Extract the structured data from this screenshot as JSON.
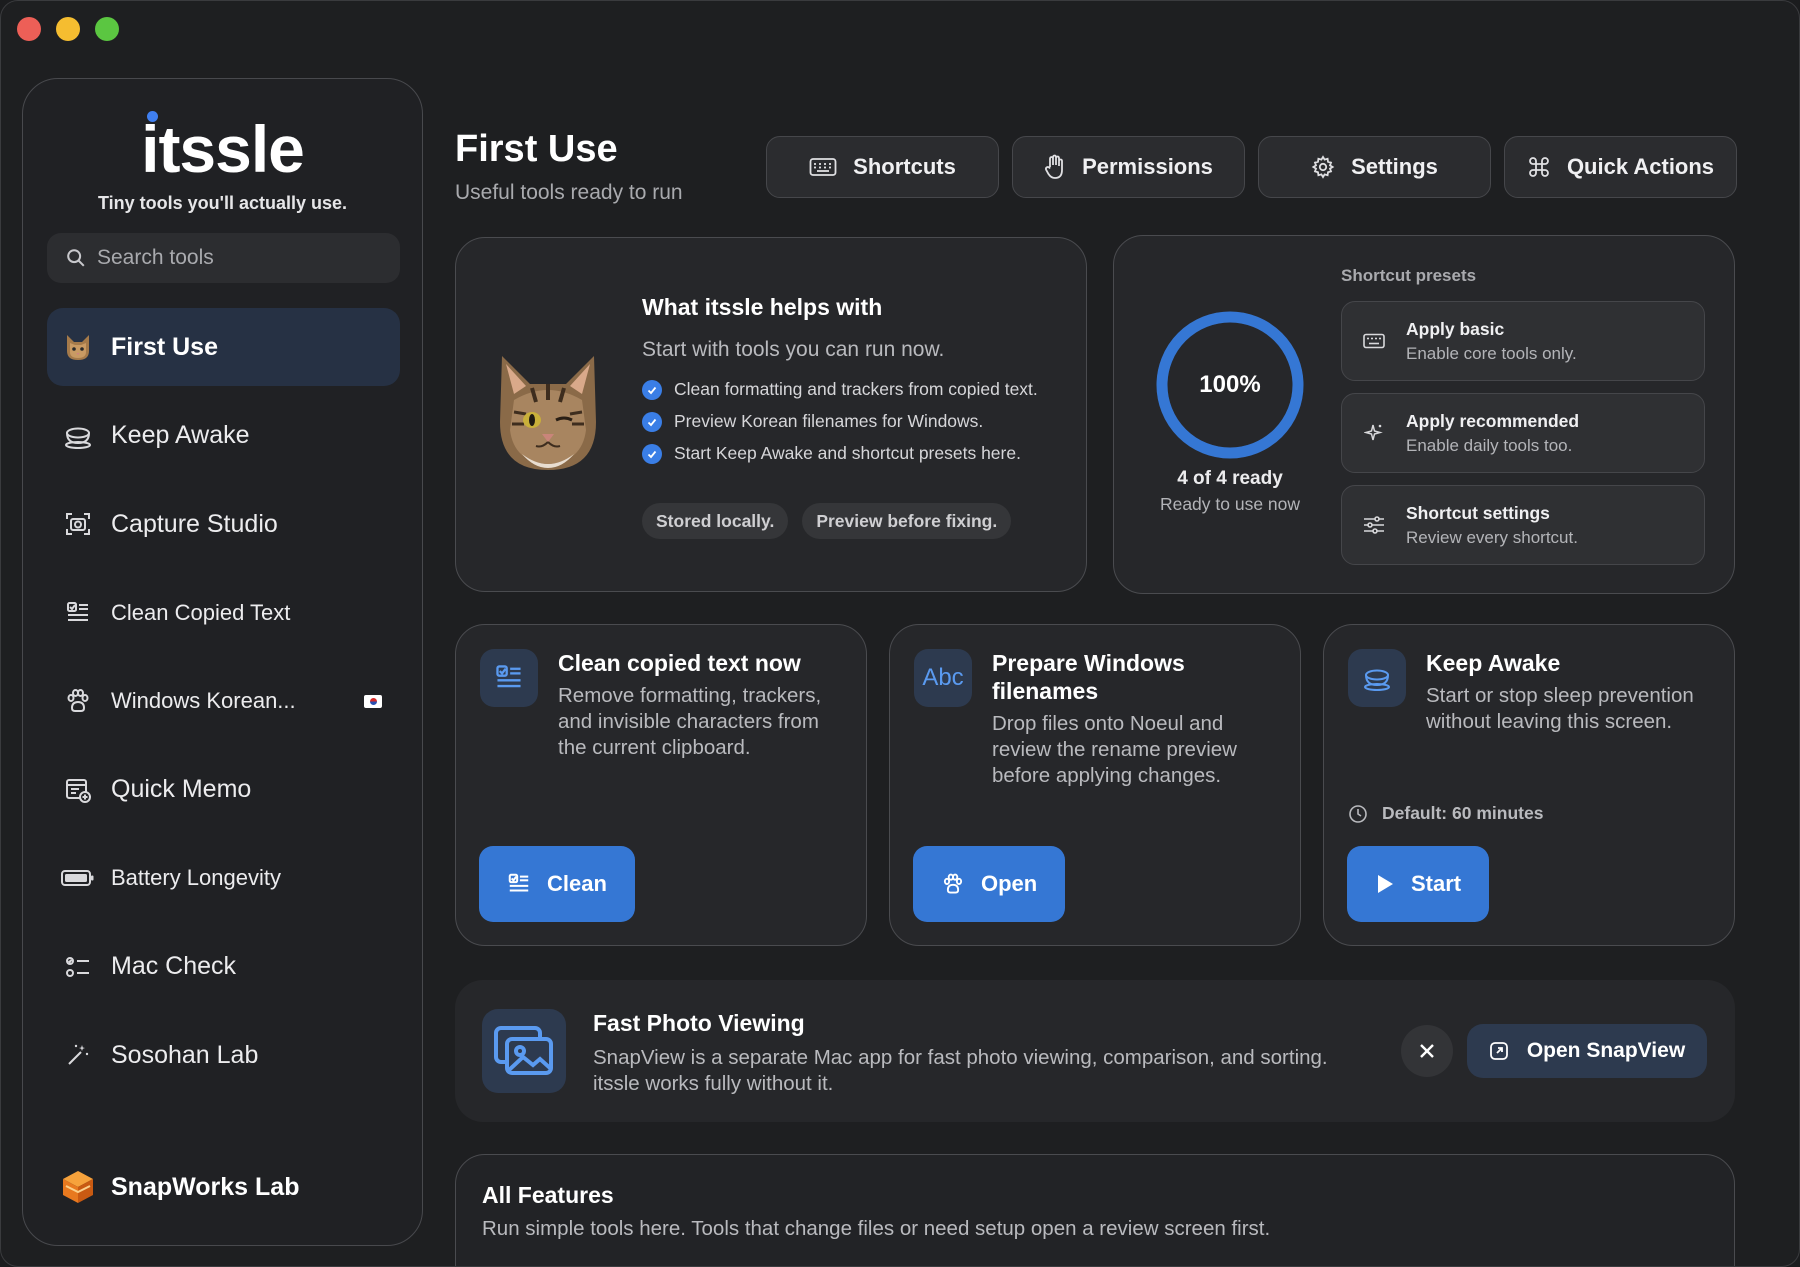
{
  "window": {
    "controls": [
      "close",
      "minimize",
      "maximize"
    ]
  },
  "sidebar": {
    "brand": "itssle",
    "tagline": "Tiny tools you'll actually use.",
    "search_placeholder": "Search tools",
    "items": [
      {
        "label": "First Use",
        "icon": "cat-icon",
        "active": true
      },
      {
        "label": "Keep Awake",
        "icon": "cup-icon"
      },
      {
        "label": "Capture Studio",
        "icon": "camera-viewfinder-icon"
      },
      {
        "label": "Clean Copied Text",
        "icon": "text-check-icon"
      },
      {
        "label": "Windows Korean...",
        "icon": "paw-icon",
        "badge": "korea-flag-icon"
      },
      {
        "label": "Quick Memo",
        "icon": "memo-add-icon"
      },
      {
        "label": "Battery Longevity",
        "icon": "battery-icon"
      },
      {
        "label": "Mac Check",
        "icon": "checklist-icon"
      },
      {
        "label": "Sosohan Lab",
        "icon": "magic-wand-icon"
      }
    ],
    "footer": "SnapWorks Lab"
  },
  "header": {
    "title": "First Use",
    "subtitle": "Useful tools ready to run",
    "buttons": [
      {
        "label": "Shortcuts",
        "icon": "keyboard-icon"
      },
      {
        "label": "Permissions",
        "icon": "hand-icon"
      },
      {
        "label": "Settings",
        "icon": "gear-icon"
      },
      {
        "label": "Quick Actions",
        "icon": "command-icon"
      }
    ]
  },
  "hero": {
    "title": "What itssle helps with",
    "subtitle": "Start with tools you can run now.",
    "checks": [
      "Clean formatting and trackers from copied text.",
      "Preview Korean filenames for Windows.",
      "Start Keep Awake and shortcut presets here."
    ],
    "pills": [
      "Stored locally.",
      "Preview before fixing."
    ]
  },
  "readiness": {
    "percent_label": "100%",
    "progress": 1.0,
    "count_label": "4 of 4 ready",
    "status": "Ready to use now"
  },
  "presets": {
    "heading": "Shortcut presets",
    "items": [
      {
        "title": "Apply basic",
        "subtitle": "Enable core tools only.",
        "icon": "keyboard-icon"
      },
      {
        "title": "Apply recommended",
        "subtitle": "Enable daily tools too.",
        "icon": "sparkle-icon"
      },
      {
        "title": "Shortcut settings",
        "subtitle": "Review every shortcut.",
        "icon": "sliders-icon"
      }
    ]
  },
  "tools": [
    {
      "title": "Clean copied text now",
      "description": "Remove formatting, trackers, and invisible characters from the current clipboard.",
      "button": "Clean",
      "icon": "text-check-icon"
    },
    {
      "title": "Prepare Windows filenames",
      "description": "Drop files onto Noeul and review the rename preview before applying changes.",
      "button": "Open",
      "icon": "abc-icon",
      "icon_text": "Abc"
    },
    {
      "title": "Keep Awake",
      "description": "Start or stop sleep prevention without leaving this screen.",
      "button": "Start",
      "meta": "Default: 60 minutes",
      "icon": "cup-icon"
    }
  ],
  "banner": {
    "title": "Fast Photo Viewing",
    "description": "SnapView is a separate Mac app for fast photo viewing, comparison, and sorting. itssle works fully without it.",
    "action": "Open SnapView"
  },
  "all_features": {
    "title": "All Features",
    "description": "Run simple tools here. Tools that change files or need setup open a review screen first."
  },
  "colors": {
    "accent": "#3577d4",
    "background": "#1e1f21",
    "card": "#26272a",
    "active_nav": "#263144"
  }
}
